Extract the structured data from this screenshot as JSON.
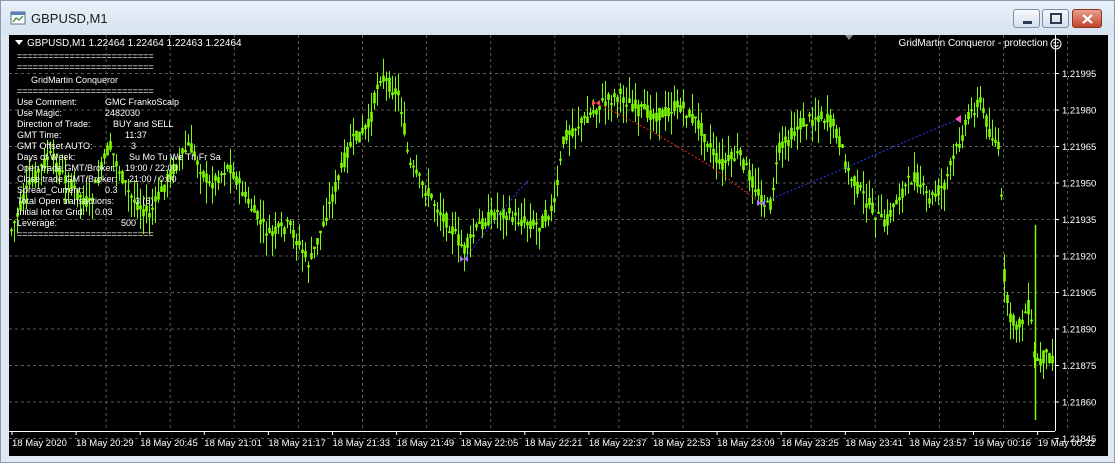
{
  "window": {
    "title": "GBPUSD,M1"
  },
  "chart": {
    "header": "GBPUSD,M1  1.22464 1.22464 1.22463 1.22464",
    "ea_label": "GridMartin Conqueror - protection",
    "colors": {
      "background": "#000000",
      "candles": "#7cfc00",
      "grid": "#5a5a5a",
      "buy_line": "#2b3dff",
      "sell_line": "#ff2020",
      "text": "#ffffff"
    },
    "price_labels": [
      "1.21995",
      "1.21980",
      "1.21965",
      "1.21950",
      "1.21935",
      "1.21920",
      "1.21905",
      "1.21890",
      "1.21875",
      "1.21860",
      "1.21845"
    ],
    "time_labels": [
      "18 May 2020",
      "18 May 20:29",
      "18 May 20:45",
      "18 May 21:01",
      "18 May 21:17",
      "18 May 21:33",
      "18 May 21:49",
      "18 May 22:05",
      "18 May 22:21",
      "18 May 22:37",
      "18 May 22:53",
      "18 May 23:09",
      "18 May 23:25",
      "18 May 23:41",
      "18 May 23:57",
      "19 May 00:16",
      "19 May 00:32"
    ]
  },
  "info_panel": {
    "separator": "==========================",
    "ea_name": "GridMartin Conqueror",
    "rows": [
      {
        "key": "Use Comment:",
        "value": "GMC FrankoScalp"
      },
      {
        "key": "Use Magic:",
        "value": "2482030"
      },
      {
        "key": "Direction of Trade:",
        "value": "BUY and SELL"
      },
      {
        "key": "GMT Time:",
        "value": "11:37"
      },
      {
        "key": "GMT Offset AUTO:",
        "value": "3"
      },
      {
        "key": "Days of Week:",
        "value": "Su  Mo  Tu  We  Th  Fr  Sa"
      },
      {
        "key": "Open trade GMT/Broker:",
        "value": "19:00 / 22:00"
      },
      {
        "key": "Close trade GMT/Broker:",
        "value": "21:00 / 0:00"
      },
      {
        "key": "Spread_Current:",
        "value": "0.3"
      },
      {
        "key": "Total Open transactions:",
        "value": "3 (6)"
      },
      {
        "key": "Initial lot for Grid:",
        "value": "0.03"
      },
      {
        "key": "Leverage:",
        "value": "500"
      }
    ]
  }
}
